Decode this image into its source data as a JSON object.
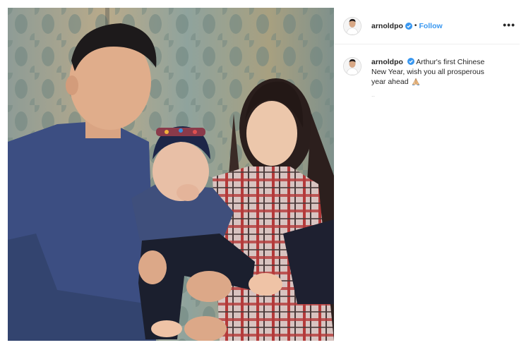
{
  "post": {
    "username": "arnoldpo",
    "follow_label": "Follow",
    "separator": "•",
    "more_label": "•••",
    "caption_username": "arnoldpo",
    "caption_text": "Arthur's first Chinese New Year, wish you all prosperous year ahead",
    "caption_emoji": "folded-hands-icon",
    "caption_trailing": "..",
    "verified_icon": "verified-badge-icon"
  },
  "colors": {
    "follow_blue": "#3897f0",
    "verified_blue": "#3897f0",
    "text": "#262626",
    "divider": "#efefef"
  }
}
